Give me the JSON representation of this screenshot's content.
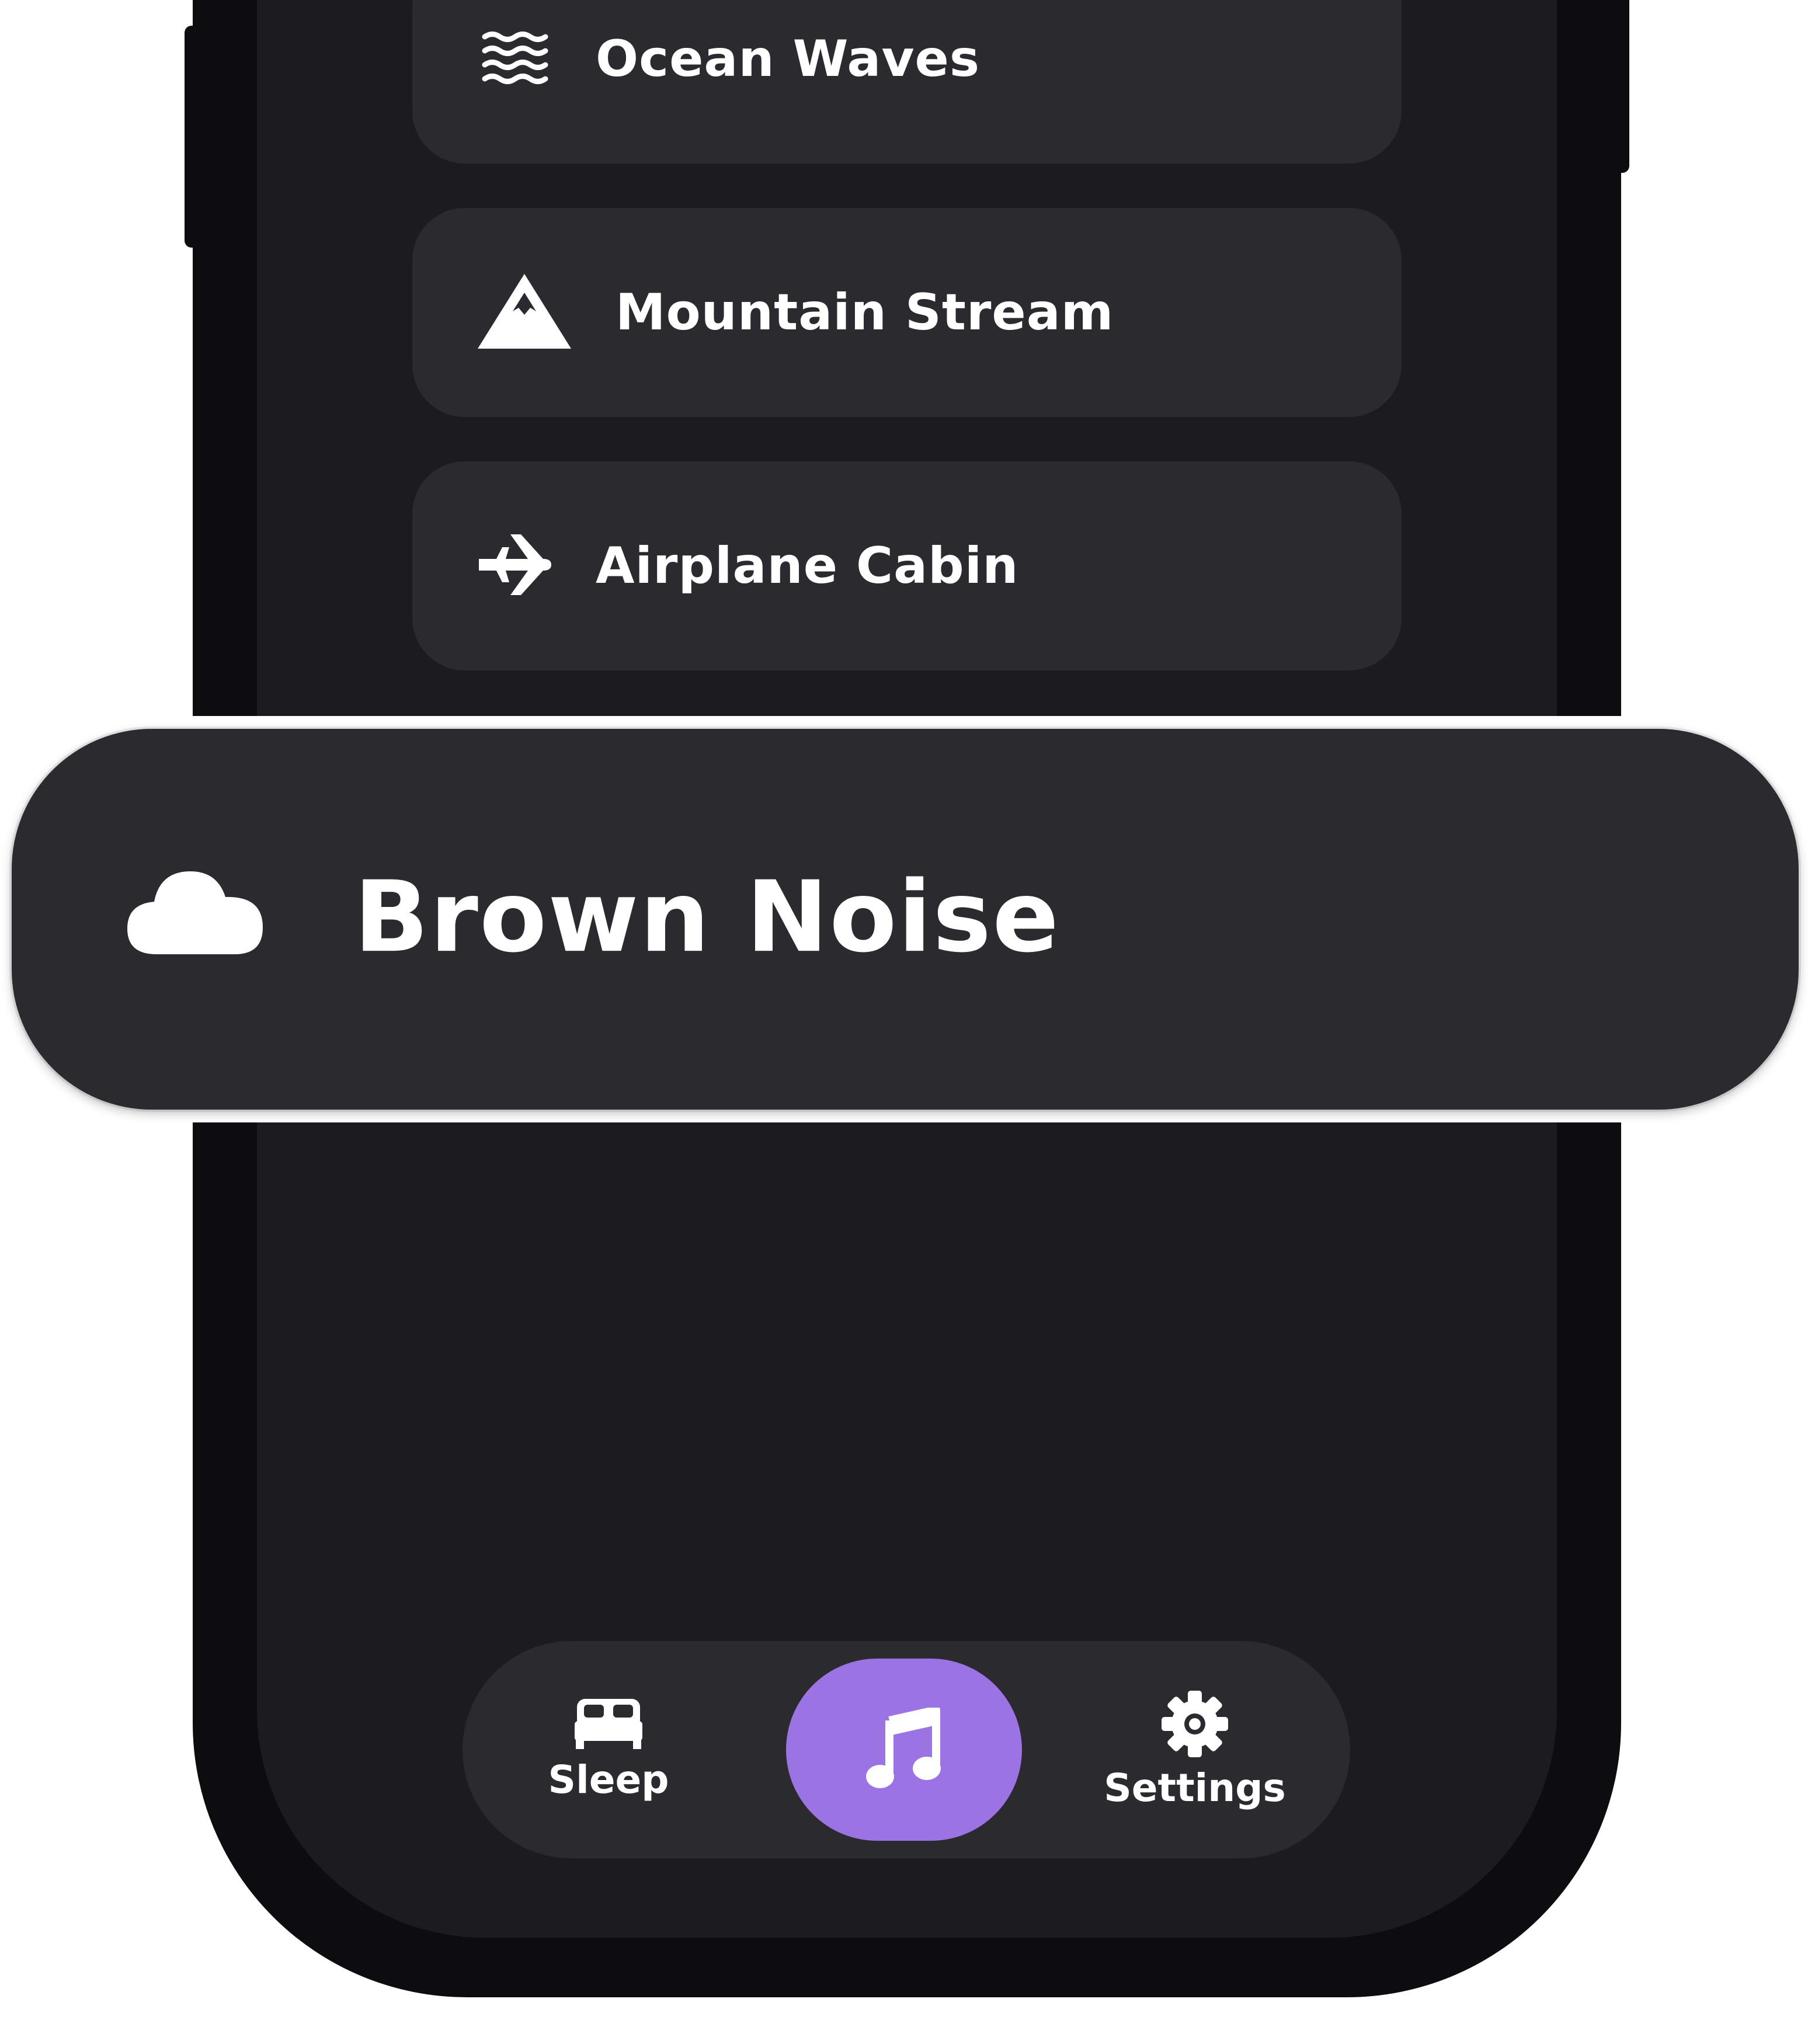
{
  "sound_list": {
    "items": [
      {
        "label": "Ocean Waves",
        "icon": "waves-icon"
      },
      {
        "label": "Mountain Stream",
        "icon": "mountain-icon"
      },
      {
        "label": "Airplane Cabin",
        "icon": "airplane-icon"
      }
    ]
  },
  "highlight": {
    "label": "Brown Noise",
    "icon": "cloud-icon"
  },
  "tabbar": {
    "sleep_label": "Sleep",
    "sleep_icon": "bed-icon",
    "music_icon": "music-note-icon",
    "settings_label": "Settings",
    "settings_icon": "gear-icon",
    "active_tab": "music"
  },
  "colors": {
    "background": "#1c1c1f",
    "card": "#2a2a2f",
    "accent": "#9b73e3",
    "text": "#ffffff"
  }
}
